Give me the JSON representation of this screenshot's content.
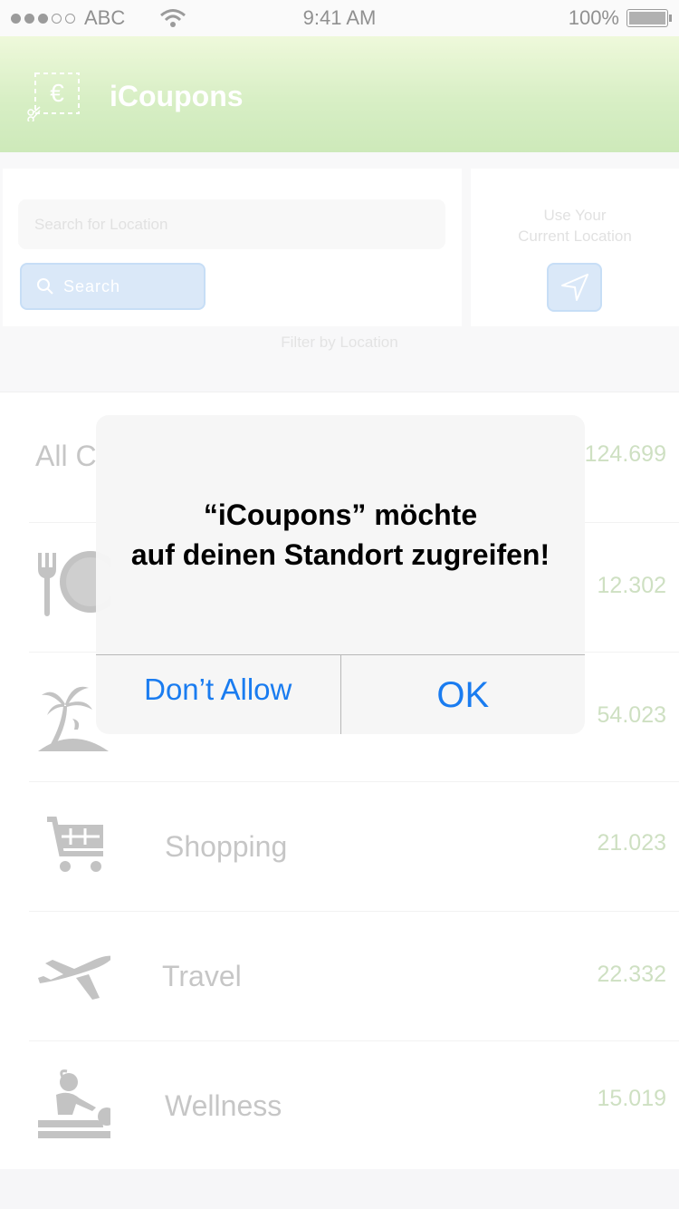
{
  "status_bar": {
    "carrier": "ABC",
    "time": "9:41 AM",
    "battery": "100%",
    "signal_bars_filled": 3,
    "signal_bars_total": 5
  },
  "header": {
    "title": "iCoupons",
    "logo_symbol": "€",
    "icon": "coupon-euro-icon"
  },
  "search": {
    "placeholder": "Search for Location",
    "button_label": "Search",
    "current_location_line1": "Use Your",
    "current_location_line2": "Current Location",
    "filter_label": "Filter by Location"
  },
  "categories": [
    {
      "label": "All C",
      "count": "124.699",
      "icon": "all-categories"
    },
    {
      "label": "",
      "count": "12.302",
      "icon": "food-icon"
    },
    {
      "label": "",
      "count": "54.023",
      "icon": "island-icon"
    },
    {
      "label": "Shopping",
      "count": "21.023",
      "icon": "shopping-cart-icon"
    },
    {
      "label": "Travel",
      "count": "22.332",
      "icon": "airplane-icon"
    },
    {
      "label": "Wellness",
      "count": "15.019",
      "icon": "massage-icon"
    }
  ],
  "alert": {
    "title_line1": "“iCoupons” möchte",
    "title_line2": "auf deinen Standort zugreifen!",
    "deny_label": "Don’t Allow",
    "ok_label": "OK"
  },
  "colors": {
    "header_green": "#c3e6a6",
    "button_blue": "#c6dcf4",
    "count_green": "#b4cfa2",
    "alert_action_blue": "#1a7cf0"
  }
}
